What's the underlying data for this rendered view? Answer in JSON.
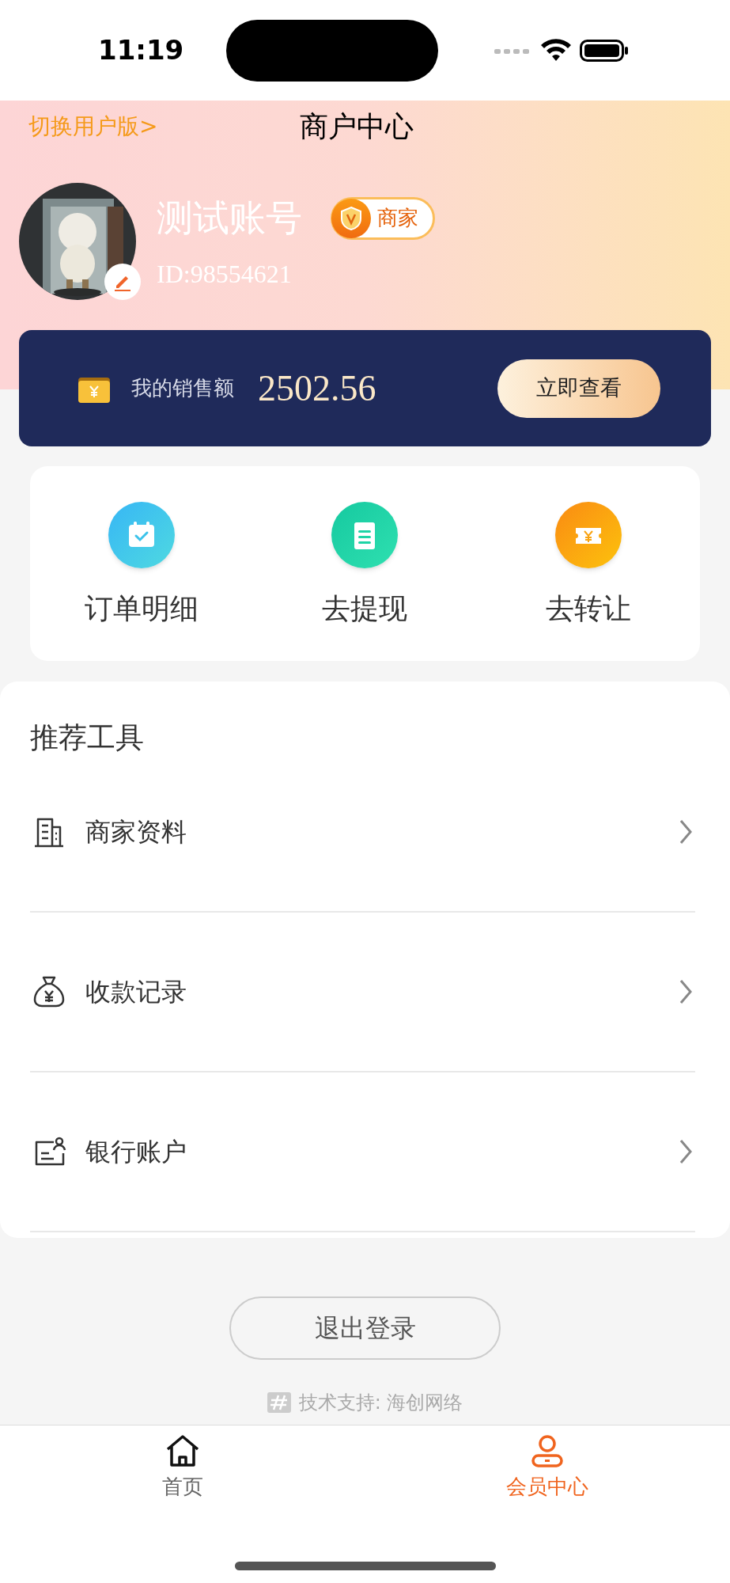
{
  "status_bar": {
    "time": "11:19"
  },
  "header": {
    "switch_link": "切换用户版>",
    "title": "商户中心"
  },
  "profile": {
    "name": "测试账号",
    "badge": "商家",
    "id": "ID:98554621"
  },
  "sales": {
    "label": "我的销售额",
    "amount": "2502.56",
    "button": "立即查看"
  },
  "actions": [
    {
      "label": "订单明细",
      "kind": "calendar"
    },
    {
      "label": "去提现",
      "kind": "clipboard"
    },
    {
      "label": "去转让",
      "kind": "ticket"
    }
  ],
  "tools": {
    "title": "推荐工具",
    "items": [
      {
        "label": "商家资料",
        "kind": "building"
      },
      {
        "label": "收款记录",
        "kind": "moneybag"
      },
      {
        "label": "银行账户",
        "kind": "card"
      }
    ]
  },
  "logout": "退出登录",
  "footer": {
    "credit": "技术支持: 海创网络"
  },
  "tab_bar": [
    {
      "label": "首页",
      "kind": "home",
      "selected": false
    },
    {
      "label": "会员中心",
      "kind": "member",
      "selected": true
    }
  ]
}
